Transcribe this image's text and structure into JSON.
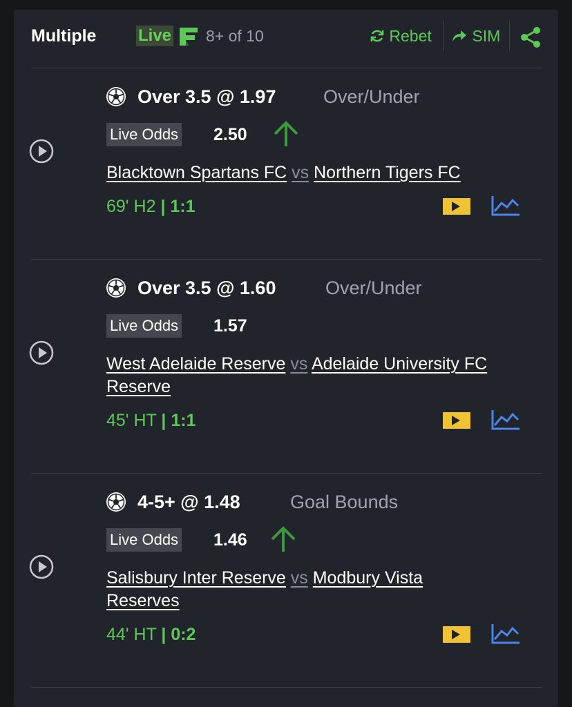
{
  "header": {
    "title": "Multiple",
    "live_label": "Live",
    "count": "8+ of 10",
    "rebet_label": "Rebet",
    "sim_label": "SIM"
  },
  "colors": {
    "accent_green": "#5cc857",
    "live_up_arrow": "#3a9a3d",
    "tv_icon": "#f1c232",
    "stats_icon": "#4a86e8",
    "card_bg": "#22242b"
  },
  "icons": [
    "rebet-refresh-icon",
    "sim-forward-icon",
    "share-icon",
    "play-icon",
    "soccer-ball-icon",
    "up-arrow-icon",
    "live-tv-icon",
    "stats-chart-icon"
  ],
  "legs": [
    {
      "selection": "Over 3.5 @ 1.97",
      "market": "Over/Under",
      "live_odds_label": "Live Odds",
      "live_odds": "2.50",
      "trend": "up",
      "home": "Blacktown Spartans FC",
      "vs": "vs",
      "away": "Northern Tigers FC",
      "time": "69' H2",
      "sep": "|",
      "score": "1:1"
    },
    {
      "selection": "Over 3.5 @ 1.60",
      "market": "Over/Under",
      "live_odds_label": "Live Odds",
      "live_odds": "1.57",
      "trend": "none",
      "home": "West Adelaide Reserve",
      "vs": "vs",
      "away": "Adelaide University FC Reserve",
      "time": "45' HT",
      "sep": "|",
      "score": "1:1"
    },
    {
      "selection": "4-5+ @ 1.48",
      "market": "Goal Bounds",
      "live_odds_label": "Live Odds",
      "live_odds": "1.46",
      "trend": "up",
      "home": "Salisbury Inter Reserve",
      "vs": "vs",
      "away": "Modbury Vista Reserves",
      "time": "44' HT",
      "sep": "|",
      "score": "0:2"
    }
  ]
}
